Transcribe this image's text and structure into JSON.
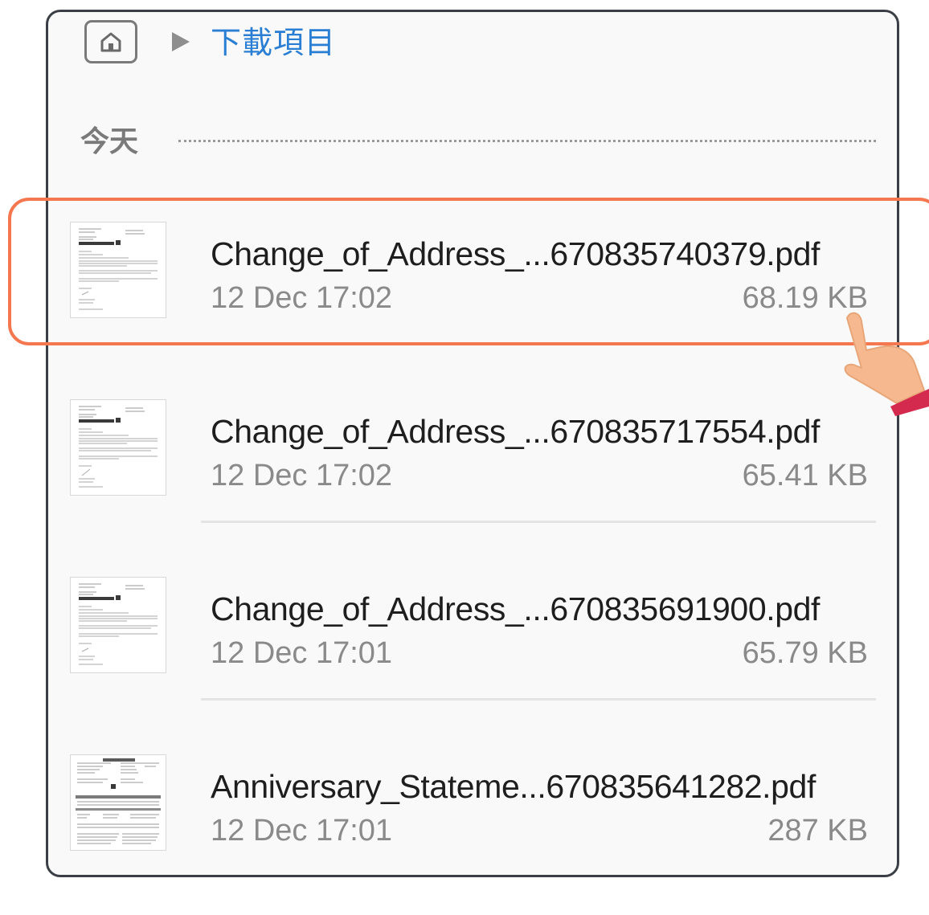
{
  "breadcrumb": {
    "home_icon": "home-icon",
    "separator_icon": "triangle-right-icon",
    "current": "下載項目"
  },
  "section": {
    "label": "今天"
  },
  "files": [
    {
      "name": "Change_of_Address_...670835740379.pdf",
      "date": "12 Dec 17:02",
      "size": "68.19 KB",
      "selected": true
    },
    {
      "name": "Change_of_Address_...670835717554.pdf",
      "date": "12 Dec 17:02",
      "size": "65.41 KB",
      "selected": false
    },
    {
      "name": "Change_of_Address_...670835691900.pdf",
      "date": "12 Dec 17:01",
      "size": "65.79 KB",
      "selected": false
    },
    {
      "name": "Anniversary_Stateme...670835641282.pdf",
      "date": "12 Dec 17:01",
      "size": "287 KB",
      "selected": false
    }
  ],
  "colors": {
    "breadcrumb_link": "#2a7fd4",
    "highlight": "#f4774f",
    "hand_skin": "#f6b98f",
    "cuff": "#d42a4e"
  }
}
